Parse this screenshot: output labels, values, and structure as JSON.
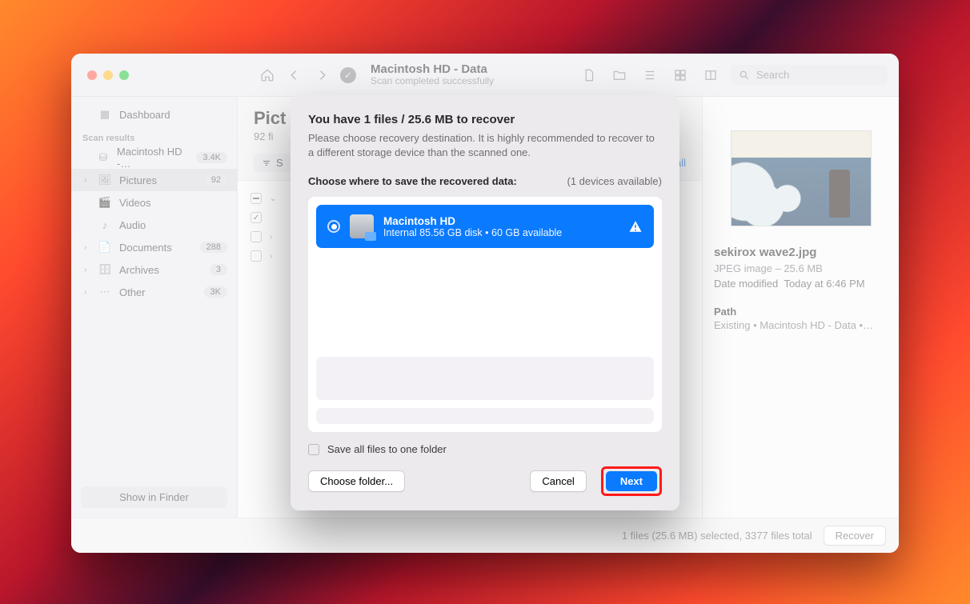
{
  "titlebar": {
    "scan_target": "Macintosh HD - Data",
    "scan_status": "Scan completed successfully",
    "search_placeholder": "Search"
  },
  "sidebar": {
    "dashboard": "Dashboard",
    "results_header": "Scan results",
    "items": [
      {
        "label": "Macintosh HD -…",
        "badge": "3.4K",
        "icon": "drive",
        "chev": ""
      },
      {
        "label": "Pictures",
        "badge": "92",
        "icon": "image",
        "chev": "›",
        "selected": true
      },
      {
        "label": "Videos",
        "badge": "",
        "icon": "video",
        "chev": ""
      },
      {
        "label": "Audio",
        "badge": "",
        "icon": "audio",
        "chev": ""
      },
      {
        "label": "Documents",
        "badge": "288",
        "icon": "doc",
        "chev": "›"
      },
      {
        "label": "Archives",
        "badge": "3",
        "icon": "archive",
        "chev": "›"
      },
      {
        "label": "Other",
        "badge": "3K",
        "icon": "other",
        "chev": "›"
      }
    ],
    "show_in_finder": "Show in Finder"
  },
  "main": {
    "title": "Pict",
    "subtitle": "92 fi",
    "filter_label_fragment": "S",
    "reset": "Reset all"
  },
  "inspector": {
    "filename": "sekirox wave2.jpg",
    "kind": "JPEG image – 25.6 MB",
    "modified_label": "Date modified",
    "modified_value": "Today at 6:46 PM",
    "path_label": "Path",
    "path_value": "Existing • Macintosh HD - Data •…"
  },
  "footer": {
    "status": "1 files (25.6 MB) selected, 3377 files total",
    "recover": "Recover"
  },
  "dialog": {
    "headline": "You have 1 files / 25.6 MB to recover",
    "description": "Please choose recovery destination. It is highly recommended to recover to a different storage device than the scanned one.",
    "choose_label": "Choose where to save the recovered data:",
    "devices_available": "(1 devices available)",
    "device": {
      "name": "Macintosh HD",
      "detail": "Internal 85.56 GB disk • 60 GB available"
    },
    "save_one_folder": "Save all files to one folder",
    "choose_folder": "Choose folder...",
    "cancel": "Cancel",
    "next": "Next"
  }
}
